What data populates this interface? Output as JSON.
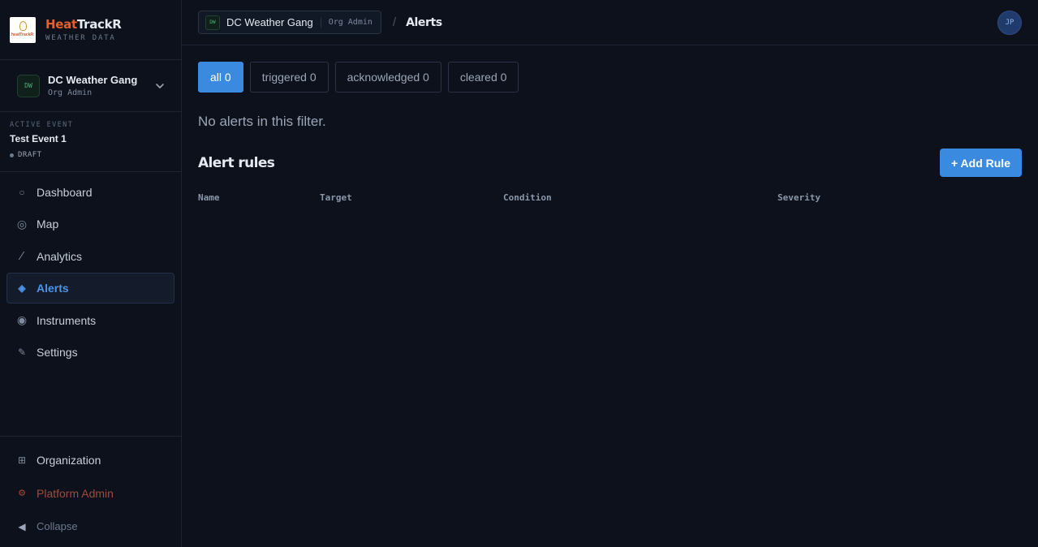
{
  "brand": {
    "name_part1": "Heat",
    "name_part2": "TrackR",
    "subtitle": "WEATHER DATA",
    "logo_text": "heatTrackR"
  },
  "org": {
    "initials": "DW",
    "name": "DC Weather Gang",
    "role": "Org Admin"
  },
  "event": {
    "label": "ACTIVE EVENT",
    "name": "Test Event 1",
    "status": "DRAFT"
  },
  "nav": [
    {
      "label": "Dashboard",
      "icon": "circle-outline-icon"
    },
    {
      "label": "Map",
      "icon": "target-icon"
    },
    {
      "label": "Analytics",
      "icon": "slash-line-icon"
    },
    {
      "label": "Alerts",
      "icon": "diamond-icon"
    },
    {
      "label": "Instruments",
      "icon": "radio-dot-icon"
    },
    {
      "label": "Settings",
      "icon": "pencil-icon"
    }
  ],
  "bottom_nav": {
    "organization": "Organization",
    "platform_admin": "Platform Admin",
    "collapse": "Collapse"
  },
  "topbar": {
    "org_initials": "DW",
    "org_name": "DC Weather Gang",
    "org_role": "Org Admin",
    "separator": "/",
    "page": "Alerts",
    "user_initials": "JP"
  },
  "filters": [
    {
      "label": "all 0",
      "active": true
    },
    {
      "label": "triggered 0",
      "active": false
    },
    {
      "label": "acknowledged 0",
      "active": false
    },
    {
      "label": "cleared 0",
      "active": false
    }
  ],
  "empty_message": "No alerts in this filter.",
  "rules": {
    "title": "Alert rules",
    "add_button": "+ Add Rule",
    "columns": [
      "Name",
      "Target",
      "Condition",
      "Severity"
    ]
  },
  "colors": {
    "accent": "#3a8ae0",
    "brand_orange": "#e4602f",
    "background": "#0c111b"
  }
}
